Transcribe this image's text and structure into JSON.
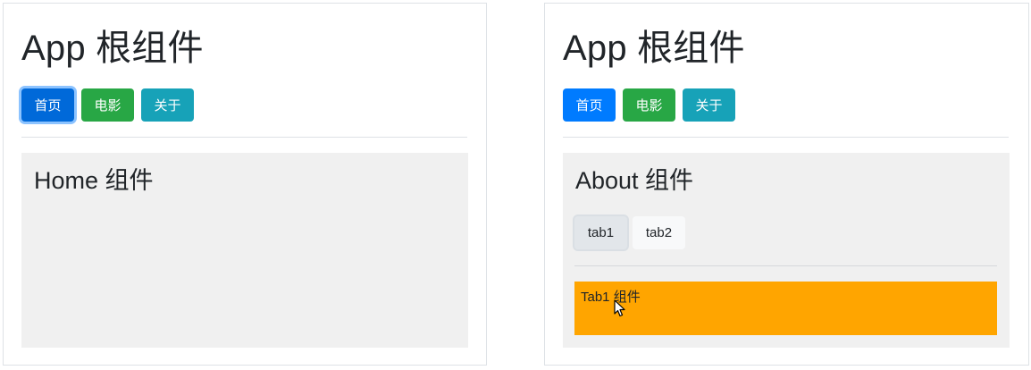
{
  "left_panel": {
    "app_title": "App 根组件",
    "nav": {
      "home": "首页",
      "movie": "电影",
      "about": "关于"
    },
    "content_title": "Home 组件"
  },
  "right_panel": {
    "app_title": "App 根组件",
    "nav": {
      "home": "首页",
      "movie": "电影",
      "about": "关于"
    },
    "content_title": "About 组件",
    "tabs": [
      {
        "label": "tab1",
        "active": true
      },
      {
        "label": "tab2",
        "active": false
      }
    ],
    "tab_content": "Tab1 组件"
  },
  "colors": {
    "home_button": "#007bff",
    "home_button_pressed": "#0069d9",
    "movie_button": "#28a745",
    "about_button": "#17a2b8",
    "content_background": "#f0f0f0",
    "tab_content_background": "#ffa500"
  },
  "icons": {
    "cursor": "mouse-pointer-icon"
  }
}
